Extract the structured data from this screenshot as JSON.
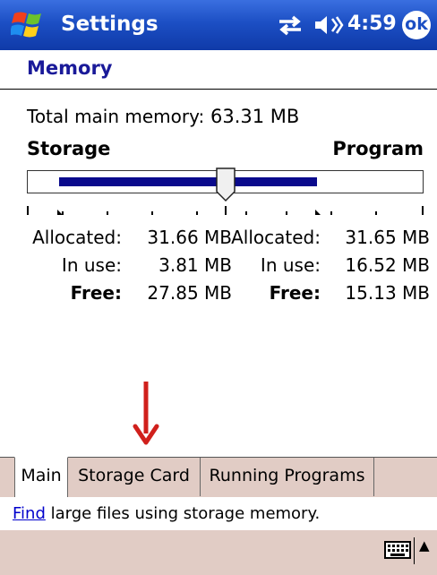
{
  "titlebar": {
    "app_title": "Settings",
    "clock": "4:59",
    "ok_label": "ok",
    "icons": [
      "windows-start-icon",
      "connectivity-icon",
      "speaker-icon"
    ]
  },
  "page": {
    "title": "Memory"
  },
  "total": {
    "label": "Total main memory:",
    "value": "63.31 MB"
  },
  "slider": {
    "left_label": "Storage",
    "right_label": "Program",
    "storage_fraction": 0.5,
    "fill_color": "#0a0a8c"
  },
  "storage": {
    "allocated_label": "Allocated:",
    "allocated_value": "31.66 MB",
    "in_use_label": "In use:",
    "in_use_value": "3.81 MB",
    "free_label": "Free:",
    "free_value": "27.85 MB"
  },
  "program": {
    "allocated_label": "Allocated:",
    "allocated_value": "31.65 MB",
    "in_use_label": "In use:",
    "in_use_value": "16.52 MB",
    "free_label": "Free:",
    "free_value": "15.13 MB"
  },
  "annotation": {
    "arrow_color": "#d0201c"
  },
  "tabs": [
    {
      "label": "Main"
    },
    {
      "label": "Storage Card"
    },
    {
      "label": "Running Programs"
    }
  ],
  "help": {
    "link_text": "Find",
    "rest_text": " large files using storage memory."
  },
  "menubar": {
    "icons": [
      "keyboard-icon",
      "sip-arrow-icon"
    ]
  },
  "colors": {
    "title_bar": "#1c4fc4",
    "page_title": "#1a1a99",
    "tab_background": "#e1ccc5",
    "link": "#0000cc"
  }
}
